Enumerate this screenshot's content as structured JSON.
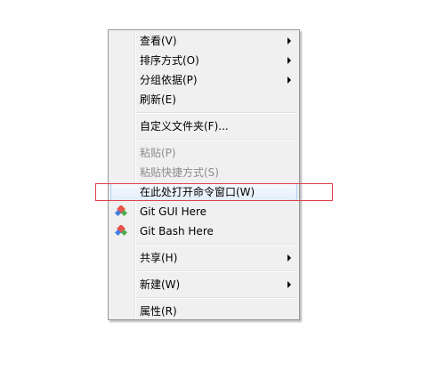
{
  "menu": {
    "items": [
      {
        "label": "查看(V)",
        "submenu": true
      },
      {
        "label": "排序方式(O)",
        "submenu": true
      },
      {
        "label": "分组依据(P)",
        "submenu": true
      },
      {
        "label": "刷新(E)"
      },
      {
        "label": "自定义文件夹(F)..."
      },
      {
        "label": "粘贴(P)",
        "disabled": true
      },
      {
        "label": "粘贴快捷方式(S)",
        "disabled": true
      },
      {
        "label": "在此处打开命令窗口(W)",
        "highlighted": true
      },
      {
        "label": "Git GUI Here",
        "icon": "git-icon"
      },
      {
        "label": "Git Bash Here",
        "icon": "git-icon"
      },
      {
        "label": "共享(H)",
        "submenu": true
      },
      {
        "label": "新建(W)",
        "submenu": true
      },
      {
        "label": "属性(R)"
      }
    ]
  },
  "colors": {
    "menu_background": "#f0f0f0",
    "highlight_border": "#e0404a",
    "disabled_text": "#8d8d8d",
    "git_icon_primary": "#e8534a",
    "git_icon_secondary": "#3d7fe0"
  }
}
